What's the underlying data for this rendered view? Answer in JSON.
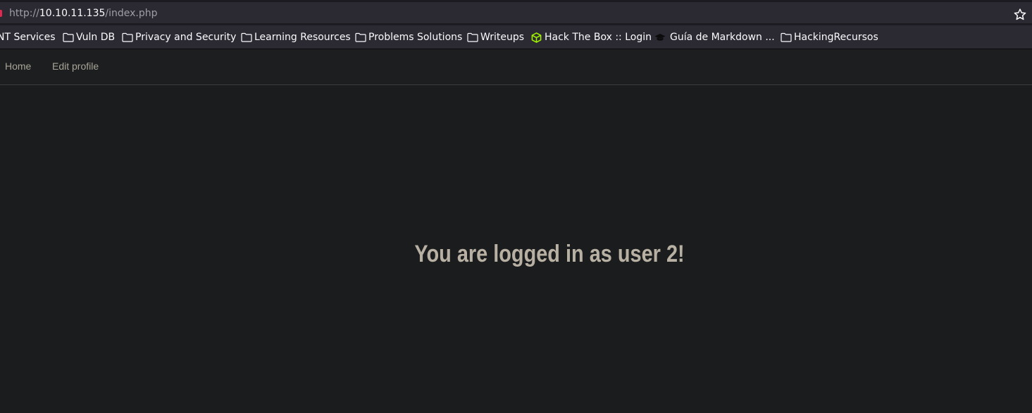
{
  "browser": {
    "url": {
      "scheme": "http://",
      "host": "10.10.11.135",
      "path": "/index.php"
    },
    "bookmarks": [
      {
        "label": "NT Services",
        "icon": "none"
      },
      {
        "label": "Vuln DB",
        "icon": "folder-icon"
      },
      {
        "label": "Privacy and Security",
        "icon": "folder-icon"
      },
      {
        "label": "Learning Resources",
        "icon": "folder-icon"
      },
      {
        "label": "Problems Solutions",
        "icon": "folder-icon"
      },
      {
        "label": "Writeups",
        "icon": "folder-icon"
      },
      {
        "label": "Hack The Box :: Login",
        "icon": "htb-cube-icon"
      },
      {
        "label": "Guía de Markdown ...",
        "icon": "graduation-cap-icon"
      },
      {
        "label": "HackingRecursos",
        "icon": "folder-icon"
      }
    ]
  },
  "nav": {
    "links": [
      {
        "label": "Home"
      },
      {
        "label": "Edit profile"
      }
    ]
  },
  "main": {
    "heading": "You are logged in as user 2!"
  },
  "colors": {
    "page_bg": "#1b1c1e",
    "heading": "#b7b0a3",
    "nav_link": "#a8a598",
    "htb_green": "#9fef00"
  }
}
